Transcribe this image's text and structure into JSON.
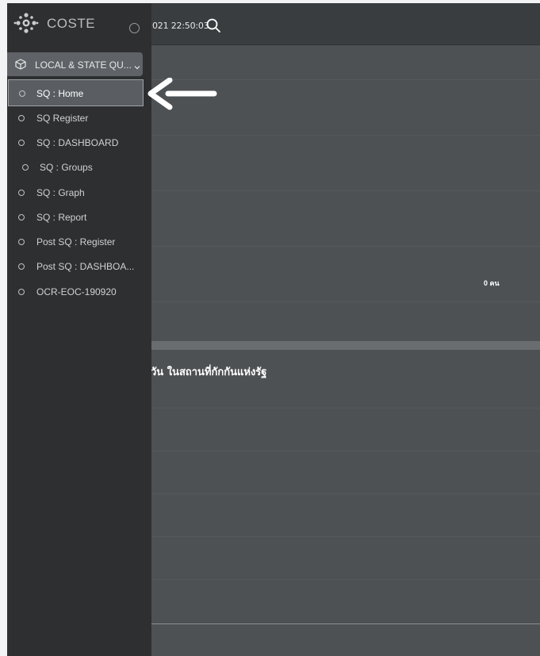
{
  "sidebar": {
    "brand": "COSTE",
    "section": {
      "label": "LOCAL & STATE QU...",
      "icon": "cube-icon"
    },
    "items": [
      {
        "label": "SQ : Home"
      },
      {
        "label": "SQ Register"
      },
      {
        "label": "SQ : DASHBOARD"
      },
      {
        "label": "SQ : Groups"
      },
      {
        "label": "SQ : Graph"
      },
      {
        "label": "SQ : Report"
      },
      {
        "label": "Post SQ : Register"
      },
      {
        "label": "Post SQ : DASHBOA..."
      },
      {
        "label": "OCR-EOC-190920"
      }
    ]
  },
  "topbar": {
    "clock": "021 22:50:03",
    "search_icon": "search-icon"
  },
  "main": {
    "count_text": "0 คน",
    "panel_title": "วัน ในสถานที่กักกันแห่งรัฐ"
  },
  "colors": {
    "sidebar": "#2d2f31",
    "main": "#4e5154",
    "topbar": "#3a3d40",
    "highlight": "#5a5e62"
  }
}
